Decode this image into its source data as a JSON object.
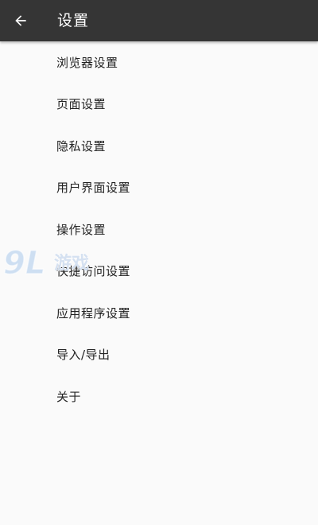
{
  "app_bar": {
    "title": "设置",
    "back_icon": "arrow-left-icon",
    "background": "#353535"
  },
  "settings": {
    "items": [
      {
        "label": "浏览器设置"
      },
      {
        "label": "页面设置"
      },
      {
        "label": "隐私设置"
      },
      {
        "label": "用户界面设置"
      },
      {
        "label": "操作设置"
      },
      {
        "label": "快捷访问设置"
      },
      {
        "label": "应用程序设置"
      },
      {
        "label": "导入/导出"
      },
      {
        "label": "关于"
      }
    ]
  },
  "watermark": {
    "logo_text": "9L游戏"
  }
}
